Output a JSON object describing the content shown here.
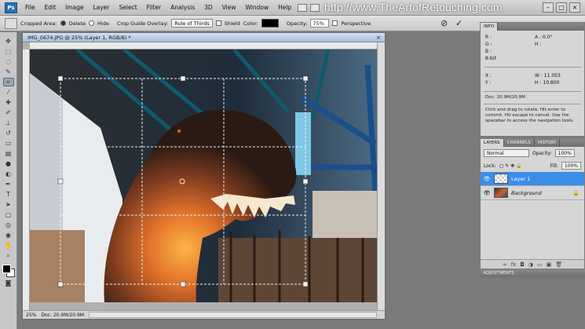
{
  "app": {
    "logo": "Ps",
    "menu": [
      "File",
      "Edit",
      "Image",
      "Layer",
      "Select",
      "Filter",
      "Analysis",
      "3D",
      "View",
      "Window",
      "Help"
    ],
    "watermark_url": "http://www.TheArtofRetouching.com"
  },
  "options_bar": {
    "cropped_area_label": "Cropped Area:",
    "delete_label": "Delete",
    "hide_label": "Hide",
    "overlay_label": "Crop Guide Overlay:",
    "overlay_value": "Rule of Thirds",
    "shield_label": "Shield",
    "color_label": "Color:",
    "opacity_label": "Opacity:",
    "opacity_value": "75%",
    "perspective_label": "Perspective",
    "cancel_glyph": "⊘",
    "commit_glyph": "✓",
    "shield_color": "#000000"
  },
  "document": {
    "title": "IMG_0674.JPG @ 25% (Layer 1, RGB/8) *",
    "zoom": "25%",
    "doc_size": "Doc: 20.9M/20.9M"
  },
  "info_panel": {
    "tab": "INFO",
    "r": "R :",
    "g": "G :",
    "b": "B :",
    "a_label": "A :",
    "a_value": "0.0°",
    "h_label": "H :",
    "eight_bit": "8-bit",
    "x_label": "X :",
    "y_label": "Y :",
    "w_label": "W :",
    "w_value": "11.053",
    "h2_label": "H :",
    "h2_value": "10.800",
    "doc": "Doc: 20.9M/20.9M",
    "hint": "Click and drag to rotate. Hit enter to commit. Hit escape to cancel. Use the spacebar to access the navigation tools."
  },
  "layers_panel": {
    "tabs": [
      "LAYERS",
      "CHANNELS",
      "HISTORY"
    ],
    "blend_mode": "Normal",
    "opacity_label": "Opacity:",
    "opacity_value": "100%",
    "lock_label": "Lock:",
    "fill_label": "Fill:",
    "fill_value": "100%",
    "layers": [
      {
        "name": "Layer 1",
        "selected": true
      },
      {
        "name": "Background",
        "selected": false
      }
    ],
    "selected_color": "#3a8ee8"
  },
  "adjustments_tab": "ADJUSTMENTS"
}
